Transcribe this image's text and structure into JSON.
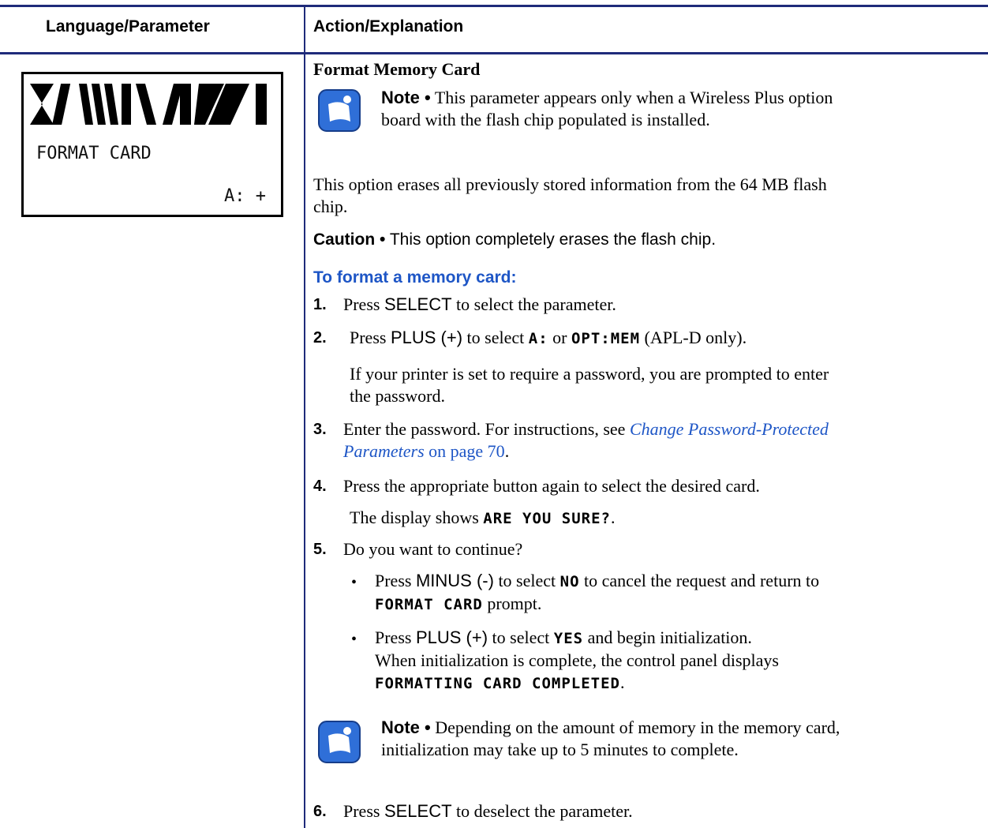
{
  "table": {
    "col1_header": "Language/Parameter",
    "col2_header": "Action/Explanation"
  },
  "lcd": {
    "label": "FORMAT CARD",
    "value": "A: +"
  },
  "section": {
    "title": "Format Memory Card",
    "note1_label": "Note •",
    "note1_text1": "This parameter appears only when a Wireless Plus option",
    "note1_text2": "board with the flash chip populated is installed.",
    "desc1": "This option erases all previously stored information from the 64 MB flash",
    "desc2": "chip.",
    "caution_label": "Caution •",
    "caution_text": "This option completely erases the flash chip.",
    "procedure_title": "To format a memory card:",
    "step1_num": "1.",
    "step1_a": "Press",
    "step1_key": "SELECT",
    "step1_b": "to select the parameter.",
    "step2_num": "2.",
    "step2_a": "Press",
    "step2_key": "PLUS (+)",
    "step2_b": "to select",
    "step2_lcd1": "A:",
    "step2_c": "or",
    "step2_lcd2": "OPT:MEM",
    "step2_d": "(APL-D only).",
    "step2_sub1": "If your printer is set to require a password, you are prompted to enter",
    "step2_sub2": "the password.",
    "step3_num": "3.",
    "step3_a": "Enter the password. For instructions, see",
    "step3_link1": "Change Password-Protected",
    "step3_link2": "Parameters",
    "step3_b": "on page 70",
    "step3_c": ".",
    "step4_num": "4.",
    "step4_a": "Press the appropriate button again to select the desired card.",
    "step4_sub_a": "The display shows",
    "step4_sub_lcd": "ARE YOU SURE?",
    "step4_sub_b": ".",
    "step5_num": "5.",
    "step5_a": "Do you want to continue?",
    "bullet1_a": "Press",
    "bullet1_key": "MINUS (-)",
    "bullet1_b": "to select",
    "bullet1_lcd": "NO",
    "bullet1_c": "to cancel the request and return to",
    "bullet1_lcd2": "FORMAT CARD",
    "bullet1_d": "prompt.",
    "bullet2_a": "Press",
    "bullet2_key": "PLUS (+)",
    "bullet2_b": "to select",
    "bullet2_lcd": "YES",
    "bullet2_c": "and begin initialization.",
    "bullet2_d": "When initialization is complete, the control panel displays",
    "bullet2_lcd2": "FORMATTING CARD COMPLETED",
    "bullet2_e": ".",
    "note2_label": "Note •",
    "note2_text1": "Depending on the amount of memory in the memory card,",
    "note2_text2": "initialization may take up to 5 minutes to complete.",
    "step6_num": "6.",
    "step6_a": "Press",
    "step6_key": "SELECT",
    "step6_b": "to deselect the parameter."
  }
}
